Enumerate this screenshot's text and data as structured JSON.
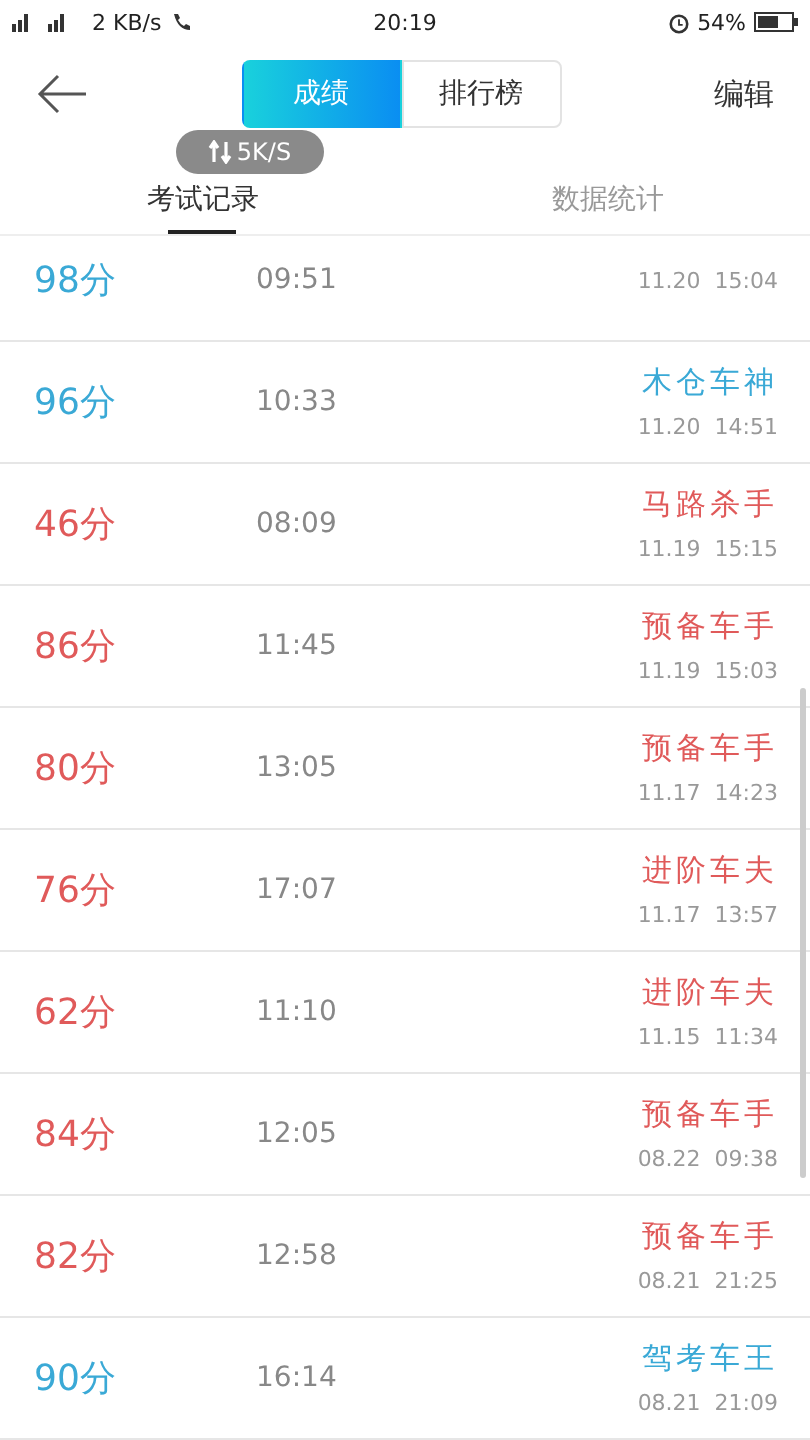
{
  "status_bar": {
    "network": "2 KB/s",
    "time": "20:19",
    "battery": "54%"
  },
  "header": {
    "segments": [
      {
        "label": "成绩",
        "selected": true
      },
      {
        "label": "排行榜",
        "selected": false
      }
    ],
    "action": "编辑"
  },
  "speed_badge": "5K/S",
  "tabs": [
    {
      "label": "考试记录",
      "selected": true
    },
    {
      "label": "数据统计",
      "selected": false
    }
  ],
  "records": [
    {
      "score": "98分",
      "duration": "09:51",
      "date": "11.20  15:04",
      "color": "#3aa9d6"
    },
    {
      "score": "96分",
      "duration": "10:33",
      "title": "木仓车神",
      "date": "11.20  14:51",
      "color": "#3aa9d6"
    },
    {
      "score": "46分",
      "duration": "08:09",
      "title": "马路杀手",
      "date": "11.19  15:15",
      "color": "#e05a5a"
    },
    {
      "score": "86分",
      "duration": "11:45",
      "title": "预备车手",
      "date": "11.19  15:03",
      "color": "#e05a5a"
    },
    {
      "score": "80分",
      "duration": "13:05",
      "title": "预备车手",
      "date": "11.17  14:23",
      "color": "#e05a5a"
    },
    {
      "score": "76分",
      "duration": "17:07",
      "title": "进阶车夫",
      "date": "11.17  13:57",
      "color": "#e05a5a"
    },
    {
      "score": "62分",
      "duration": "11:10",
      "title": "进阶车夫",
      "date": "11.15  11:34",
      "color": "#e05a5a"
    },
    {
      "score": "84分",
      "duration": "12:05",
      "title": "预备车手",
      "date": "08.22  09:38",
      "color": "#e05a5a"
    },
    {
      "score": "82分",
      "duration": "12:58",
      "title": "预备车手",
      "date": "08.21  21:25",
      "color": "#e05a5a"
    },
    {
      "score": "90分",
      "duration": "16:14",
      "title": "驾考车王",
      "date": "08.21  21:09",
      "color": "#3aa9d6"
    }
  ]
}
